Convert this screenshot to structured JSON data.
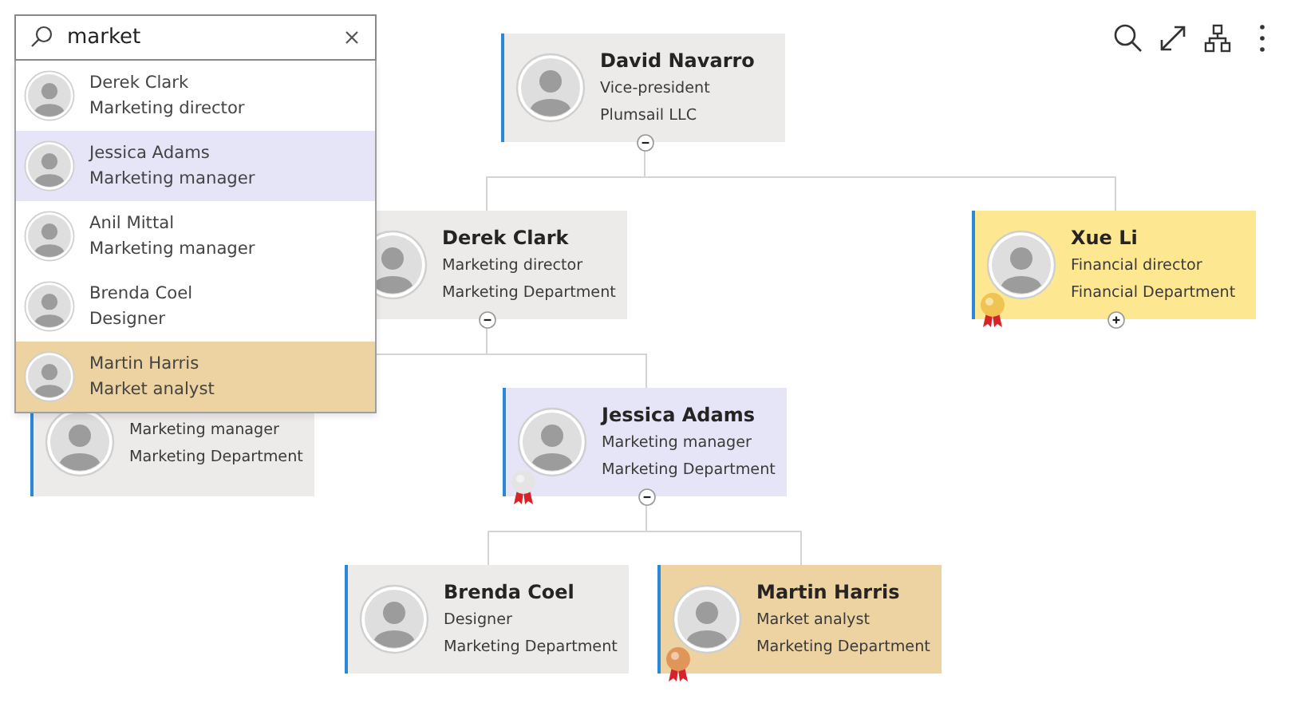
{
  "search": {
    "value": "market"
  },
  "results": [
    {
      "name": "Derek Clark",
      "title": "Marketing director",
      "color": "#ffffff"
    },
    {
      "name": "Jessica Adams",
      "title": "Marketing manager",
      "color": "#e6e5f8"
    },
    {
      "name": "Anil Mittal",
      "title": "Marketing manager",
      "color": "#ffffff"
    },
    {
      "name": "Brenda Coel",
      "title": "Designer",
      "color": "#ffffff"
    },
    {
      "name": "Martin Harris",
      "title": "Market analyst",
      "color": "#ecd3a1"
    }
  ],
  "chart": {
    "root": {
      "name": "David Navarro",
      "title": "Vice-president",
      "department": "Plumsail LLC",
      "color": "#edebe9",
      "expanded": true,
      "children": [
        {
          "name": "Derek Clark",
          "title": "Marketing director",
          "department": "Marketing Department",
          "color": "#edebe9",
          "expanded": true,
          "children": [
            {
              "title": "Marketing manager",
              "department": "Marketing Department",
              "color": "#edebe9"
            },
            {
              "name": "Jessica Adams",
              "title": "Marketing manager",
              "department": "Marketing Department",
              "color": "#e6e5f8",
              "medal": {
                "color": "#e4e4e4"
              },
              "expanded": true,
              "children": [
                {
                  "name": "Brenda Coel",
                  "title": "Designer",
                  "department": "Marketing Department",
                  "color": "#edebe9"
                },
                {
                  "name": "Martin Harris",
                  "title": "Market analyst",
                  "department": "Marketing Department",
                  "color": "#ecd3a1",
                  "medal": {
                    "color": "#e0955a"
                  }
                }
              ]
            }
          ]
        },
        {
          "name": "Xue Li",
          "title": "Financial director",
          "department": "Financial Department",
          "color": "#fde891",
          "medal": {
            "color": "#f0c452"
          },
          "expanded": false
        }
      ]
    }
  }
}
